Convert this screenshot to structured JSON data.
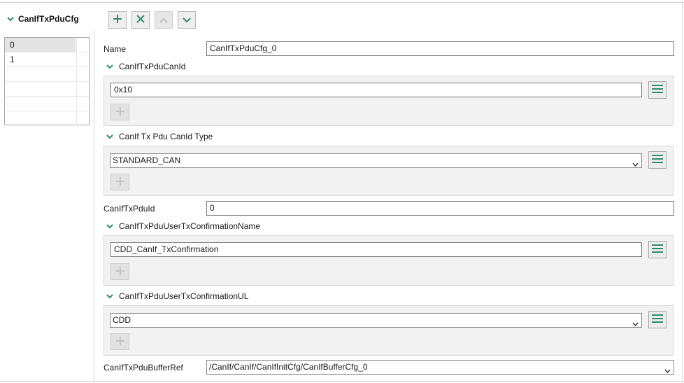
{
  "container": {
    "title": "CanIfTxPduCfg",
    "expanded_icon": "chevron-down-icon"
  },
  "toolbar": {
    "add_icon": "plus-icon",
    "delete_icon": "close-icon",
    "move_up_icon": "chevron-up-icon",
    "move_down_icon": "chevron-down-icon"
  },
  "instances": [
    {
      "label": "0",
      "selected": true
    },
    {
      "label": "1",
      "selected": false
    },
    {
      "label": "",
      "selected": false
    },
    {
      "label": "",
      "selected": false
    },
    {
      "label": "",
      "selected": false
    },
    {
      "label": "",
      "selected": false
    }
  ],
  "fields": {
    "name": {
      "label": "Name",
      "value": "CanIfTxPduCfg_0"
    },
    "can_id": {
      "title": "CanIfTxPduCanId",
      "value": "0x10"
    },
    "can_id_type": {
      "title": "CanIf Tx Pdu CanId Type",
      "value": "STANDARD_CAN"
    },
    "pdu_id": {
      "label": "CanIfTxPduId",
      "value": "0"
    },
    "tx_confirmation_name": {
      "title": "CanIfTxPduUserTxConfirmationName",
      "value": "CDD_CanIf_TxConfirmation"
    },
    "tx_confirmation_ul": {
      "title": "CanIfTxPduUserTxConfirmationUL",
      "value": "CDD"
    },
    "buffer_ref": {
      "label": "CanIfTxPduBufferRef",
      "value": "/CanIf/CanIf/CanIfInitCfg/CanIfBufferCfg_0"
    }
  },
  "icons": {
    "list": "list-icon",
    "add_value": "plus-icon",
    "dropdown": "dropdown-arrow-icon"
  },
  "colors": {
    "accent": "#2e8b6e",
    "disabled_icon": "#bdbdbd"
  }
}
